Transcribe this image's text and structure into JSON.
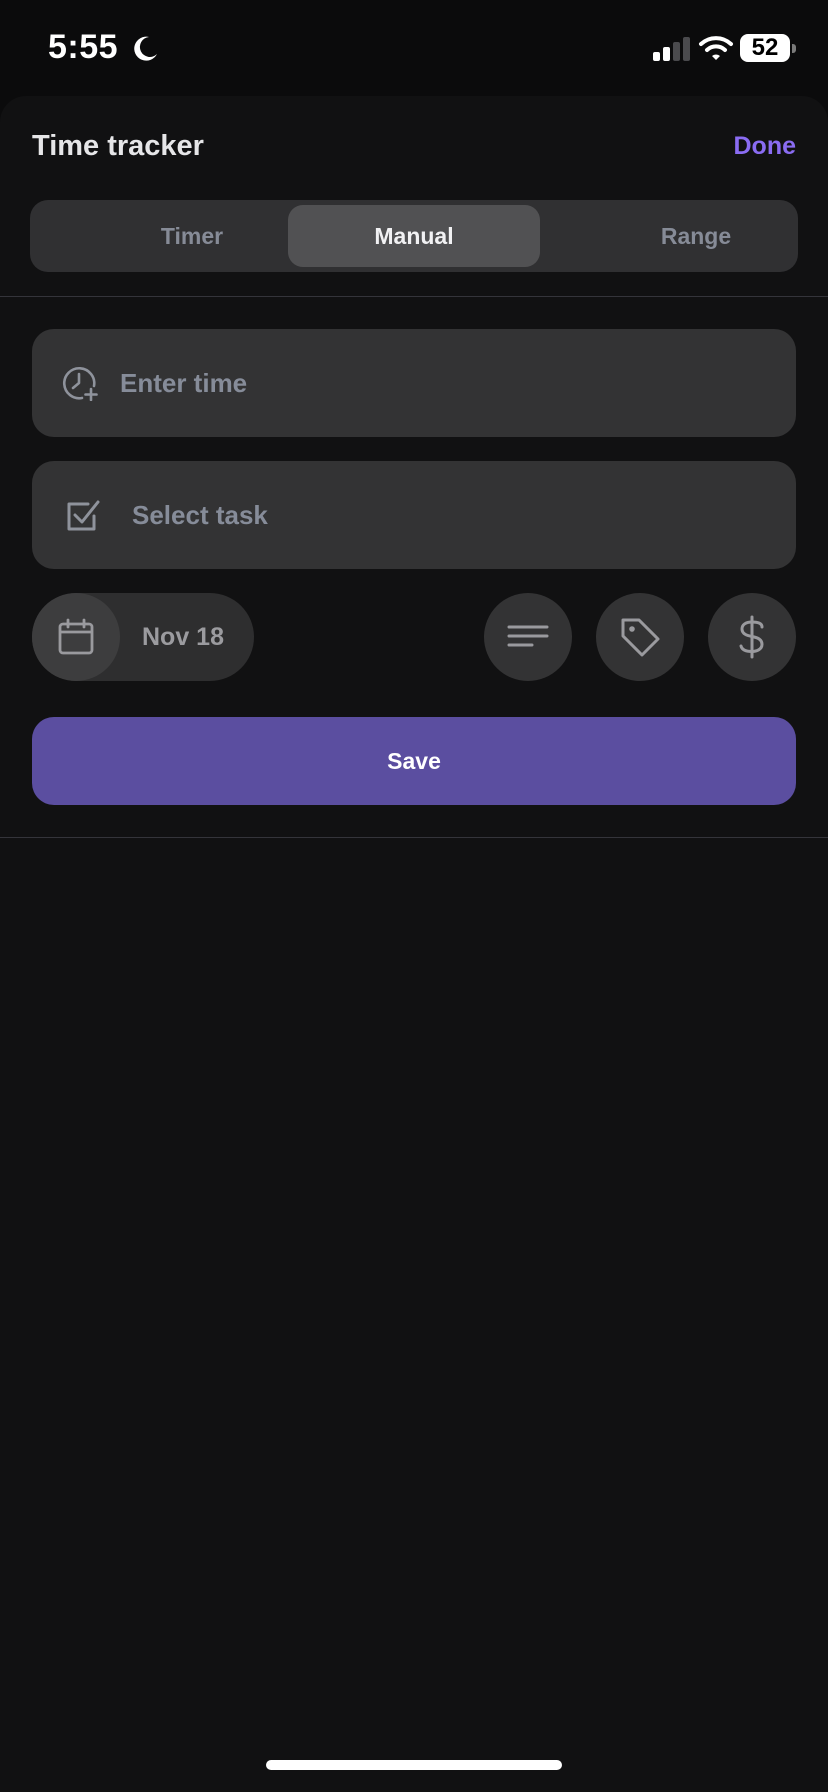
{
  "status_bar": {
    "time": "5:55",
    "battery": "52",
    "icons": [
      "moon-icon",
      "signal-icon",
      "wifi-icon",
      "battery-icon"
    ]
  },
  "sheet": {
    "title": "Time tracker",
    "done_label": "Done"
  },
  "tabs": [
    {
      "label": "Timer",
      "selected": false
    },
    {
      "label": "Manual",
      "selected": true
    },
    {
      "label": "Range",
      "selected": false
    }
  ],
  "fields": {
    "time_placeholder": "Enter time",
    "task_placeholder": "Select task"
  },
  "actions": {
    "date_label": "Nov 18",
    "icons": [
      "calendar-icon",
      "description-icon",
      "tag-icon",
      "dollar-icon"
    ]
  },
  "save_label": "Save",
  "colors": {
    "accent": "#8a6cf2",
    "save_button": "#5b4ea0",
    "sheet_background": "#111112",
    "field_background": "#333334"
  }
}
